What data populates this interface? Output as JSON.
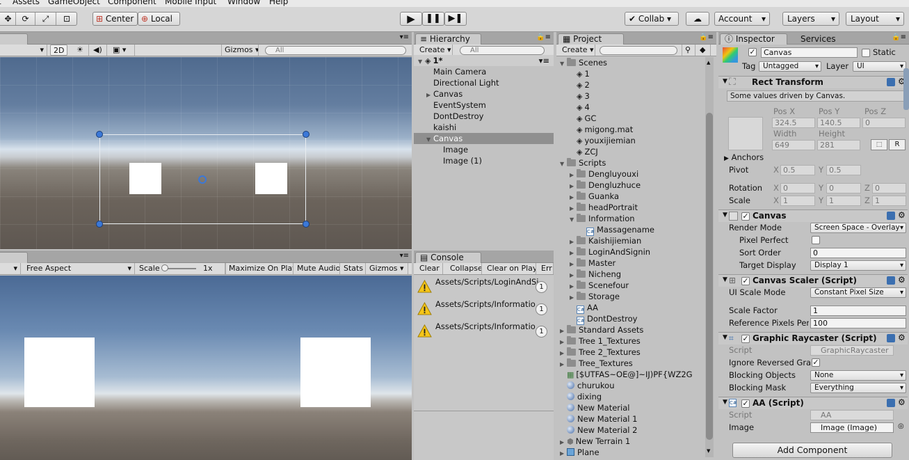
{
  "menu": {
    "items": [
      "t",
      "Assets",
      "GameObject",
      "Component",
      "Mobile Input",
      "Window",
      "Help"
    ]
  },
  "toolbar": {
    "center": "Center",
    "local": "Local",
    "collab": "Collab",
    "account": "Account",
    "layers": "Layers",
    "layout": "Layout"
  },
  "scene": {
    "mode_2d": "2D",
    "gizmos": "Gizmos",
    "search_placeholder": "All"
  },
  "game": {
    "aspect": "Free Aspect",
    "scale_label": "Scale",
    "scale_value": "1x",
    "maximize": "Maximize On Play",
    "mute": "Mute Audio",
    "stats": "Stats",
    "gizmos": "Gizmos"
  },
  "hierarchy": {
    "tab": "Hierarchy",
    "create": "Create",
    "search_placeholder": "All",
    "scene_name": "1*",
    "items": [
      {
        "label": "Main Camera",
        "indent": 0,
        "arrow": ""
      },
      {
        "label": "Directional Light",
        "indent": 0,
        "arrow": ""
      },
      {
        "label": "Canvas",
        "indent": 0,
        "arrow": "▶"
      },
      {
        "label": "EventSystem",
        "indent": 0,
        "arrow": ""
      },
      {
        "label": "DontDestroy",
        "indent": 0,
        "arrow": ""
      },
      {
        "label": "kaishi",
        "indent": 0,
        "arrow": ""
      },
      {
        "label": "Canvas",
        "indent": 0,
        "arrow": "▼",
        "selected": true
      },
      {
        "label": "Image",
        "indent": 1,
        "arrow": ""
      },
      {
        "label": "Image (1)",
        "indent": 1,
        "arrow": ""
      }
    ]
  },
  "console": {
    "tab": "Console",
    "buttons": [
      "Clear",
      "Collapse",
      "Clear on Play",
      "Err"
    ],
    "messages": [
      {
        "text": "Assets/Scripts/LoginAndSi",
        "count": "1"
      },
      {
        "text": "Assets/Scripts/Informatio",
        "count": "1"
      },
      {
        "text": "Assets/Scripts/Informatio",
        "count": "1"
      }
    ]
  },
  "project": {
    "tab": "Project",
    "create": "Create",
    "items": [
      {
        "label": "Scenes",
        "type": "folder",
        "arrow": "▼",
        "level": 0
      },
      {
        "label": "1",
        "type": "scene",
        "level": 1
      },
      {
        "label": "2",
        "type": "scene",
        "level": 1
      },
      {
        "label": "3",
        "type": "scene",
        "level": 1
      },
      {
        "label": "4",
        "type": "scene",
        "level": 1
      },
      {
        "label": "GC",
        "type": "scene",
        "level": 1
      },
      {
        "label": "migong.mat",
        "type": "scene",
        "level": 1
      },
      {
        "label": "youxijiemian",
        "type": "scene",
        "level": 1
      },
      {
        "label": "ZCJ",
        "type": "scene",
        "level": 1
      },
      {
        "label": "Scripts",
        "type": "folder",
        "arrow": "▼",
        "level": 0
      },
      {
        "label": "Dengluyouxi",
        "type": "folder",
        "arrow": "▶",
        "level": 1
      },
      {
        "label": "Dengluzhuce",
        "type": "folder",
        "arrow": "▶",
        "level": 1
      },
      {
        "label": "Guanka",
        "type": "folder",
        "arrow": "▶",
        "level": 1
      },
      {
        "label": "headPortrait",
        "type": "folder",
        "arrow": "▶",
        "level": 1
      },
      {
        "label": "Information",
        "type": "folder",
        "arrow": "▼",
        "level": 1
      },
      {
        "label": "Massagename",
        "type": "script",
        "level": 2
      },
      {
        "label": "Kaishijiemian",
        "type": "folder",
        "arrow": "▶",
        "level": 1
      },
      {
        "label": "LoginAndSignin",
        "type": "folder",
        "arrow": "▶",
        "level": 1
      },
      {
        "label": "Master",
        "type": "folder",
        "arrow": "▶",
        "level": 1
      },
      {
        "label": "Nicheng",
        "type": "folder",
        "arrow": "▶",
        "level": 1
      },
      {
        "label": "Scenefour",
        "type": "folder",
        "arrow": "▶",
        "level": 1
      },
      {
        "label": "Storage",
        "type": "folder",
        "arrow": "▶",
        "level": 1
      },
      {
        "label": "AA",
        "type": "script",
        "level": 1
      },
      {
        "label": "DontDestroy",
        "type": "script",
        "level": 1
      },
      {
        "label": "Standard Assets",
        "type": "folder",
        "arrow": "▶",
        "level": 0
      },
      {
        "label": "Tree 1_Textures",
        "type": "folder",
        "arrow": "▶",
        "level": 0
      },
      {
        "label": "Tree 2_Textures",
        "type": "folder",
        "arrow": "▶",
        "level": 0
      },
      {
        "label": "Tree_Textures",
        "type": "folder",
        "arrow": "▶",
        "level": 0
      },
      {
        "label": "[$UTFAS~OE@]~IJ)PF{WZ2G",
        "type": "texture",
        "level": 0
      },
      {
        "label": "churukou",
        "type": "material",
        "level": 0
      },
      {
        "label": "dixing",
        "type": "material",
        "level": 0
      },
      {
        "label": "New Material",
        "type": "material",
        "level": 0
      },
      {
        "label": "New Material 1",
        "type": "material",
        "level": 0
      },
      {
        "label": "New Material 2",
        "type": "material",
        "level": 0
      },
      {
        "label": "New Terrain 1",
        "type": "terrain",
        "arrow": "▶",
        "level": 0
      },
      {
        "label": "Plane",
        "type": "prefab",
        "arrow": "▶",
        "level": 0
      }
    ]
  },
  "inspector": {
    "tab": "Inspector",
    "tab2": "Services",
    "object_name": "Canvas",
    "static_label": "Static",
    "tag_label": "Tag",
    "tag_value": "Untagged",
    "layer_label": "Layer",
    "layer_value": "UI",
    "rect": {
      "title": "Rect Transform",
      "driven": "Some values driven by Canvas.",
      "posx_label": "Pos X",
      "posy_label": "Pos Y",
      "posz_label": "Pos Z",
      "posx": "324.5",
      "posy": "140.5",
      "posz": "0",
      "width_label": "Width",
      "height_label": "Height",
      "width": "649",
      "height": "281",
      "r_btn": "R",
      "anchors": "Anchors",
      "pivot": "Pivot",
      "pivot_x": "0.5",
      "pivot_y": "0.5",
      "rotation": "Rotation",
      "rot_x": "0",
      "rot_y": "0",
      "rot_z": "0",
      "scale": "Scale",
      "scale_x": "1",
      "scale_y": "1",
      "scale_z": "1",
      "x": "X",
      "y": "Y",
      "z": "Z"
    },
    "canvas": {
      "title": "Canvas",
      "render_mode_label": "Render Mode",
      "render_mode": "Screen Space - Overlay",
      "pixel_perfect": "Pixel Perfect",
      "sort_order_label": "Sort Order",
      "sort_order": "0",
      "target_display_label": "Target Display",
      "target_display": "Display 1"
    },
    "scaler": {
      "title": "Canvas Scaler (Script)",
      "ui_scale_label": "UI Scale Mode",
      "ui_scale": "Constant Pixel Size",
      "scale_factor_label": "Scale Factor",
      "scale_factor": "1",
      "ref_pixels_label": "Reference Pixels Per",
      "ref_pixels": "100"
    },
    "raycaster": {
      "title": "Graphic Raycaster (Script)",
      "script_label": "Script",
      "script": "GraphicRaycaster",
      "ignore_label": "Ignore Reversed Gra",
      "blocking_objects_label": "Blocking Objects",
      "blocking_objects": "None",
      "blocking_mask_label": "Blocking Mask",
      "blocking_mask": "Everything"
    },
    "aa": {
      "title": "AA (Script)",
      "script_label": "Script",
      "script": "AA",
      "image_label": "Image",
      "image": "Image (Image)"
    },
    "add_component": "Add Component"
  }
}
